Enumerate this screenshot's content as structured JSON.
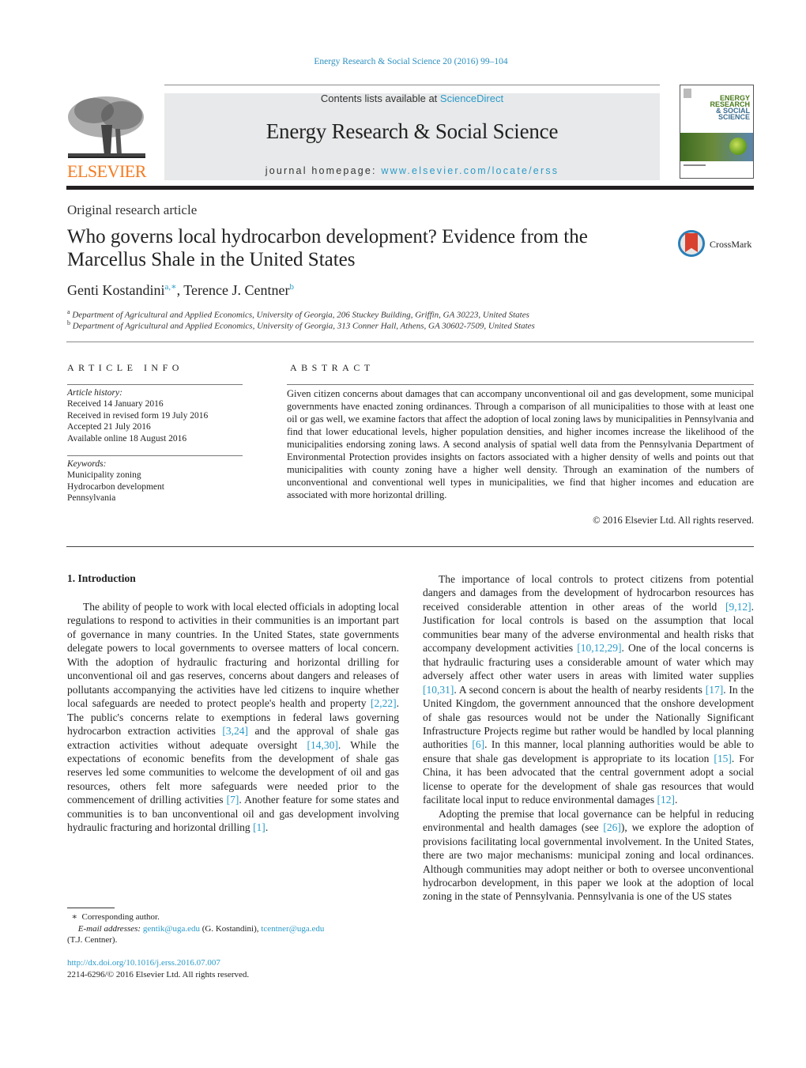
{
  "header": {
    "journal_ref": "Energy Research & Social Science 20 (2016) 99–104",
    "contents_prefix": "Contents lists available at ",
    "contents_link": "ScienceDirect",
    "journal_title": "Energy Research & Social Science",
    "homepage_prefix": "journal homepage: ",
    "homepage_link": "www.elsevier.com/locate/erss",
    "publisher_logo_text": "ELSEVIER",
    "cover_title_lines": [
      "ENERGY",
      "RESEARCH",
      "& SOCIAL",
      "SCIENCE"
    ],
    "colors": {
      "link": "#2a9bc9",
      "elsevier_orange": "#f47b20",
      "masthead_bg": "#e8e9ea"
    }
  },
  "article": {
    "type": "Original research article",
    "title": "Who governs local hydrocarbon development? Evidence from the Marcellus Shale in the United States",
    "crossmark_label": "CrossMark",
    "authors": [
      {
        "name": "Genti Kostandini",
        "sup": "a,∗"
      },
      {
        "name": "Terence J. Centner",
        "sup": "b"
      }
    ],
    "affiliations": [
      {
        "sup": "a",
        "text": "Department of Agricultural and Applied Economics, University of Georgia, 206 Stuckey Building, Griffin, GA 30223, United States"
      },
      {
        "sup": "b",
        "text": "Department of Agricultural and Applied Economics, University of Georgia, 313 Conner Hall, Athens, GA 30602-7509, United States"
      }
    ]
  },
  "article_info": {
    "heading": "ARTICLE INFO",
    "history_label": "Article history:",
    "history": [
      "Received 14 January 2016",
      "Received in revised form 19 July 2016",
      "Accepted 21 July 2016",
      "Available online 18 August 2016"
    ],
    "keywords_label": "Keywords:",
    "keywords": [
      "Municipality zoning",
      "Hydrocarbon development",
      "Pennsylvania"
    ]
  },
  "abstract": {
    "heading": "ABSTRACT",
    "text": "Given citizen concerns about damages that can accompany unconventional oil and gas development, some municipal governments have enacted zoning ordinances. Through a comparison of all municipalities to those with at least one oil or gas well, we examine factors that affect the adoption of local zoning laws by municipalities in Pennsylvania and find that lower educational levels, higher population densities, and higher incomes increase the likelihood of the municipalities endorsing zoning laws. A second analysis of spatial well data from the Pennsylvania Department of Environmental Protection provides insights on factors associated with a higher density of wells and points out that municipalities with county zoning have a higher well density. Through an examination of the numbers of unconventional and conventional well types in municipalities, we find that higher incomes and education are associated with more horizontal drilling.",
    "copyright": "© 2016 Elsevier Ltd. All rights reserved."
  },
  "body": {
    "section_heading": "1.  Introduction",
    "left_paragraph": [
      {
        "t": "The ability of people to work with local elected officials in adopting local regulations to respond to activities in their communities is an important part of governance in many countries. In the United States, state governments delegate powers to local governments to oversee matters of local concern. With the adoption of hydraulic fracturing and horizontal drilling for unconventional oil and gas reserves, concerns about dangers and releases of pollutants accompanying the activities have led citizens to inquire whether local safeguards are needed to protect people's health and property "
      },
      {
        "ref": "[2,22]"
      },
      {
        "t": ". The public's concerns relate to exemptions in federal laws governing hydrocarbon extraction activities "
      },
      {
        "ref": "[3,24]"
      },
      {
        "t": " and the approval of shale gas extraction activities without adequate oversight "
      },
      {
        "ref": "[14,30]"
      },
      {
        "t": ". While the expectations of economic benefits from the development of shale gas reserves led some communities to welcome the development of oil and gas resources, others felt more safeguards were needed prior to the commencement of drilling activities "
      },
      {
        "ref": "[7]"
      },
      {
        "t": ". Another feature for some states and communities is to ban unconventional oil and gas development involving hydraulic fracturing and horizontal drilling "
      },
      {
        "ref": "[1]"
      },
      {
        "t": "."
      }
    ],
    "right_paragraph_1": [
      {
        "t": "The importance of local controls to protect citizens from potential dangers and damages from the development of hydrocarbon resources has received considerable attention in other areas of the world "
      },
      {
        "ref": "[9,12]"
      },
      {
        "t": ". Justification for local controls is based on the assumption that local communities bear many of the adverse environmental and health risks that accompany development activities "
      },
      {
        "ref": "[10,12,29]"
      },
      {
        "t": ". One of the local concerns is that hydraulic fracturing uses a considerable amount of water which may adversely affect other water users in areas with limited water supplies "
      },
      {
        "ref": "[10,31]"
      },
      {
        "t": ". A second concern is about the health of nearby residents "
      },
      {
        "ref": "[17]"
      },
      {
        "t": ". In the United Kingdom, the government announced that the onshore development of shale gas resources would not be under the Nationally Significant Infrastructure Projects regime but rather would be handled by local planning authorities "
      },
      {
        "ref": "[6]"
      },
      {
        "t": ". In this manner, local planning authorities would be able to ensure that shale gas development is appropriate to its location "
      },
      {
        "ref": "[15]"
      },
      {
        "t": ". For China, it has been advocated that the central government adopt a social license to operate for the development of shale gas resources that would facilitate local input to reduce environmental damages "
      },
      {
        "ref": "[12]"
      },
      {
        "t": "."
      }
    ],
    "right_paragraph_2": [
      {
        "t": "Adopting the premise that local governance can be helpful in reducing environmental and health damages (see "
      },
      {
        "ref": "[26]"
      },
      {
        "t": "), we explore the adoption of provisions facilitating local governmental involvement. In the United States, there are two major mechanisms: municipal zoning and local ordinances. Although communities may adopt neither or both to oversee unconventional hydrocarbon development, in this paper we look at the adoption of local zoning in the state of Pennsylvania. Pennsylvania is one of the US states"
      }
    ]
  },
  "footnotes": {
    "corresponding_mark": "∗",
    "corresponding_text": "Corresponding author.",
    "email_label": "E-mail addresses:",
    "email_1": "gentik@uga.edu",
    "email_1_name": " (G. Kostandini), ",
    "email_2": "tcentner@uga.edu",
    "email_2_name": "(T.J. Centner).",
    "doi": "http://dx.doi.org/10.1016/j.erss.2016.07.007",
    "issn_line": "2214-6296/© 2016 Elsevier Ltd. All rights reserved."
  }
}
